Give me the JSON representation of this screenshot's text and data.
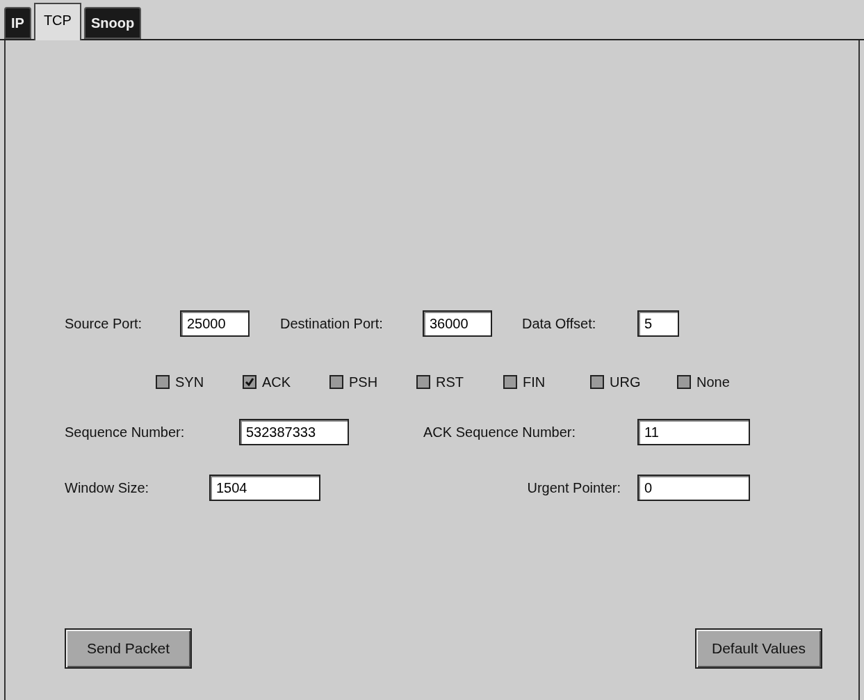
{
  "tabs": [
    {
      "label": "IP",
      "selected": false
    },
    {
      "label": "TCP",
      "selected": true
    },
    {
      "label": "Snoop",
      "selected": false
    }
  ],
  "ports": {
    "source_port": {
      "label": "Source Port:",
      "value": "25000"
    },
    "destination_port": {
      "label": "Destination Port:",
      "value": "36000"
    },
    "data_offset": {
      "label": "Data Offset:",
      "value": "5"
    }
  },
  "flags": [
    {
      "label": "SYN",
      "checked": false
    },
    {
      "label": "ACK",
      "checked": true
    },
    {
      "label": "PSH",
      "checked": false
    },
    {
      "label": "RST",
      "checked": false
    },
    {
      "label": "FIN",
      "checked": false
    },
    {
      "label": "URG",
      "checked": false
    },
    {
      "label": "None",
      "checked": false
    }
  ],
  "sequence_number": {
    "label": "Sequence Number:",
    "value": "532387333"
  },
  "ack_sequence_number": {
    "label": "ACK Sequence Number:",
    "value": "11"
  },
  "window_size": {
    "label": "Window Size:",
    "value": "1504"
  },
  "urgent_pointer": {
    "label": "Urgent Pointer:",
    "value": "0"
  },
  "buttons": [
    "Send Packet",
    "Default Values"
  ]
}
